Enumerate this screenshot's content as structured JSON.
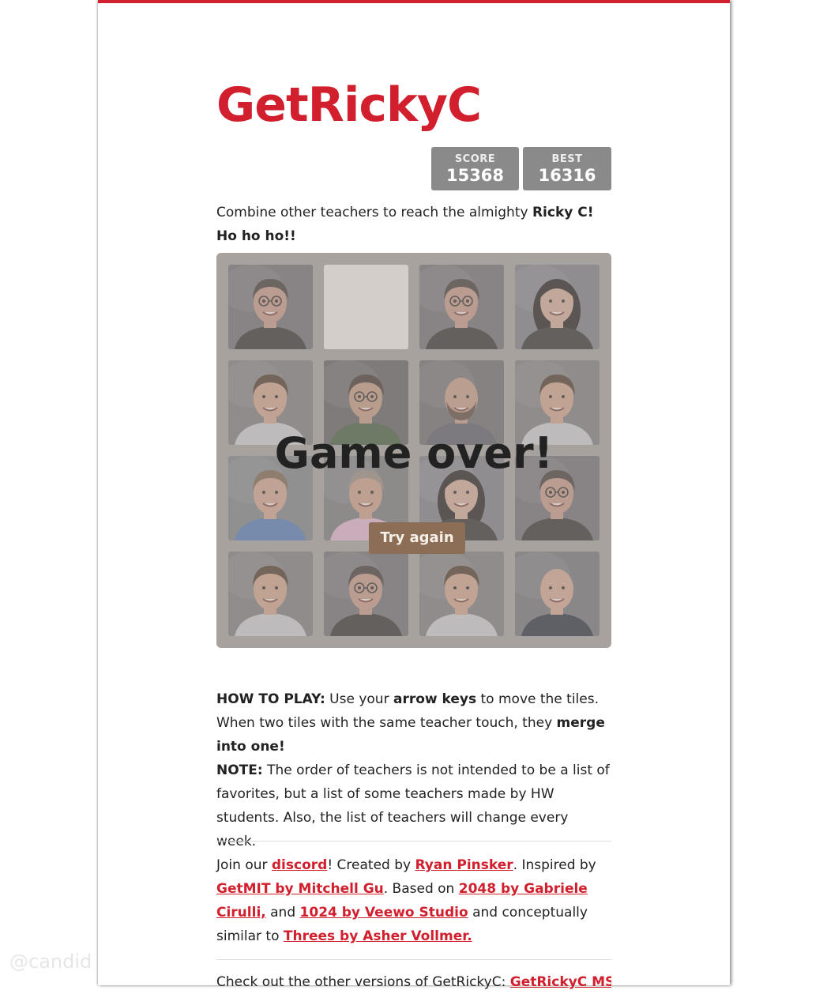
{
  "title": "GetRickyC",
  "scores": {
    "score_label": "SCORE",
    "score_value": "15368",
    "best_label": "BEST",
    "best_value": "16316"
  },
  "intro": {
    "text": "Combine other teachers to reach the almighty ",
    "bold": "Ricky C! Ho ho ho!!"
  },
  "board": {
    "tiles": [
      {
        "type": "teacher",
        "face": "glasses-man"
      },
      {
        "type": "empty"
      },
      {
        "type": "teacher",
        "face": "glasses-man"
      },
      {
        "type": "teacher",
        "face": "woman-dark-hair"
      },
      {
        "type": "teacher",
        "face": "young-man-plaid"
      },
      {
        "type": "teacher",
        "face": "woman-glasses"
      },
      {
        "type": "teacher",
        "face": "bald-beard-man"
      },
      {
        "type": "teacher",
        "face": "young-man-plaid"
      },
      {
        "type": "teacher",
        "face": "man-blue-shirt"
      },
      {
        "type": "teacher",
        "face": "man-pink-shirt"
      },
      {
        "type": "teacher",
        "face": "woman-dark-hair"
      },
      {
        "type": "teacher",
        "face": "glasses-man"
      },
      {
        "type": "teacher",
        "face": "young-man-plaid"
      },
      {
        "type": "teacher",
        "face": "glasses-man"
      },
      {
        "type": "teacher",
        "face": "young-man-plaid"
      },
      {
        "type": "teacher",
        "face": "bald-man-navy"
      }
    ],
    "game_over_text": "Game over!",
    "try_again_label": "Try again"
  },
  "howto": {
    "heading": "HOW TO PLAY:",
    "t1": " Use your ",
    "b1": "arrow keys",
    "t2": " to move the tiles. When two tiles with the same teacher touch, they ",
    "b2": "merge into one!",
    "note_heading": "NOTE:",
    "note_text": " The order of teachers is not intended to be a list of favorites, but a list of some teachers made by HW students. Also, the list of teachers will change every week."
  },
  "credits": {
    "t1": "Join our ",
    "l1": "discord",
    "t2": "! Created by ",
    "l2": "Ryan Pinsker",
    "t3": ". Inspired by ",
    "l3": "GetMIT by Mitchell Gu",
    "t4": ". Based on ",
    "l4": "2048 by Gabriele Cirulli,",
    "t5": " and ",
    "l5": "1024 by Veewo Studio",
    "t6": " and conceptually similar to ",
    "l6": "Threes by Asher Vollmer."
  },
  "others": {
    "text": "Check out the other versions of GetRickyC: ",
    "link": "GetRickyC MS"
  },
  "watermark": "@candid",
  "colors": {
    "accent": "#d11f2d",
    "score_box": "#8a8a8a",
    "board": "#a8a29e",
    "button": "#8c6d55"
  }
}
